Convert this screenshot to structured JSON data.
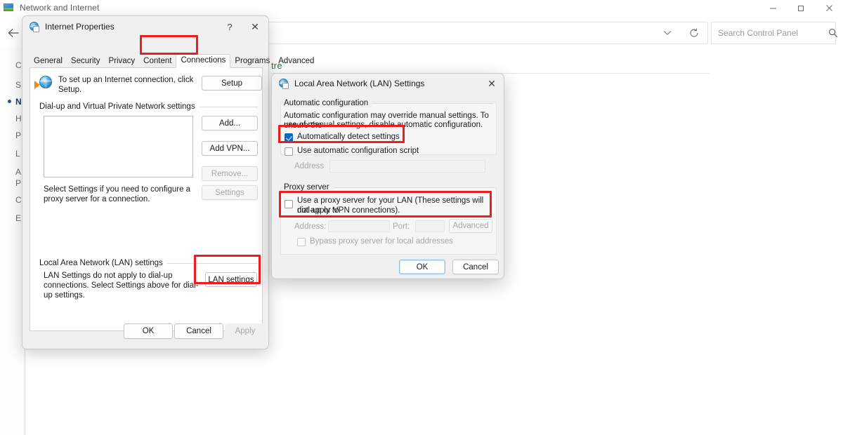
{
  "control_panel": {
    "window_title": "Network and Internet",
    "app_icon": "network-monitor-icon",
    "window_buttons": {
      "minimize": "minimize-icon",
      "maximize": "restore-icon",
      "close": "close-icon"
    },
    "back_button": "back-arrow-icon",
    "address_value": "",
    "address_chevron": "chevron-down-icon",
    "refresh": "refresh-icon",
    "search": {
      "placeholder": "Search Control Panel",
      "value": "",
      "icon": "search-icon"
    },
    "green_heading_fragment": "tre",
    "sidebar_letters": [
      "C",
      "S",
      "N",
      "H",
      "P",
      "L",
      "A",
      "P",
      "C",
      "E"
    ],
    "sidebar_current_index": 2
  },
  "internet_properties": {
    "title": "Internet Properties",
    "icon": "internet-properties-icon",
    "help_button": "?",
    "close_button": "✕",
    "tabs": [
      {
        "label": "General",
        "active": false
      },
      {
        "label": "Security",
        "active": false
      },
      {
        "label": "Privacy",
        "active": false
      },
      {
        "label": "Content",
        "active": false
      },
      {
        "label": "Connections",
        "active": true
      },
      {
        "label": "Programs",
        "active": false
      },
      {
        "label": "Advanced",
        "active": false
      }
    ],
    "setup": {
      "icon": "internet-connection-globe-icon",
      "text": "To set up an Internet connection, click Setup.",
      "button": "Setup"
    },
    "dialup_group": {
      "label": "Dial-up and Virtual Private Network settings",
      "list_items": [],
      "buttons": [
        {
          "label": "Add...",
          "disabled": false
        },
        {
          "label": "Add VPN...",
          "disabled": false
        },
        {
          "label": "Remove...",
          "disabled": true
        },
        {
          "label": "Settings",
          "disabled": true
        }
      ],
      "hint": "Select Settings if you need to configure a proxy server for a connection."
    },
    "lan_group": {
      "label": "Local Area Network (LAN) settings",
      "text": "LAN Settings do not apply to dial-up connections. Select Settings above for dial-up settings.",
      "button": "LAN settings"
    },
    "footer_buttons": [
      {
        "label": "OK",
        "disabled": false
      },
      {
        "label": "Cancel",
        "disabled": false
      },
      {
        "label": "Apply",
        "disabled": true
      }
    ]
  },
  "lan_settings": {
    "title": "Local Area Network (LAN) Settings",
    "icon": "internet-properties-icon",
    "close_button": "✕",
    "automatic_configuration": {
      "group_label": "Automatic configuration",
      "description_line1": "Automatic configuration may override manual settings.  To ensure the",
      "description_line2": "use of manual settings, disable automatic configuration.",
      "auto_detect": {
        "label": "Automatically detect settings",
        "checked": true
      },
      "auto_script": {
        "label": "Use automatic configuration script",
        "checked": false
      },
      "address_label": "Address",
      "address_value": ""
    },
    "proxy_server": {
      "group_label": "Proxy server",
      "use_proxy": {
        "label_line1": "Use a proxy server for your LAN (These settings will not apply to",
        "label_line2": "dial-up or VPN connections).",
        "checked": false
      },
      "address_label": "Address:",
      "address_value": "",
      "port_label": "Port:",
      "port_value": "",
      "advanced_button": "Advanced",
      "bypass": {
        "label": "Bypass proxy server for local addresses",
        "checked": false
      }
    },
    "footer_buttons": [
      {
        "label": "OK",
        "default": true
      },
      {
        "label": "Cancel",
        "default": false
      }
    ]
  },
  "annotations": {
    "accent_color": "#ee1d1d",
    "highlights": [
      {
        "name": "connections-tab-highlight"
      },
      {
        "name": "lan-settings-button-highlight"
      },
      {
        "name": "automatically-detect-settings-highlight"
      },
      {
        "name": "use-proxy-server-highlight"
      }
    ]
  }
}
